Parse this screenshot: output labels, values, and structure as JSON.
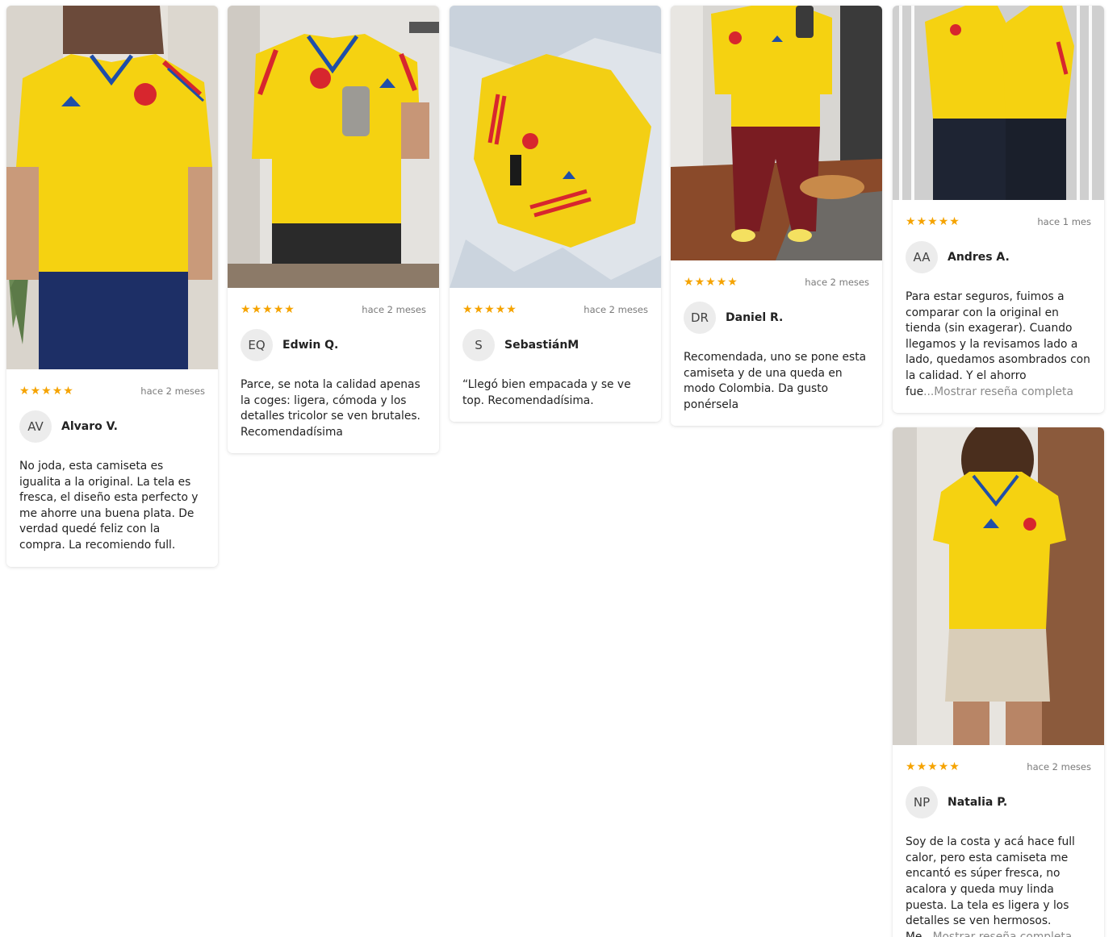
{
  "reviews": [
    {
      "stars": 5,
      "date": "hace 2 meses",
      "initials": "AV",
      "name": "Alvaro V.",
      "text": "No joda, esta camiseta es igualita a la original. La tela es fresca, el diseño esta perfecto y me ahorre una buena plata. De verdad quedé feliz con la compra. La recomiendo full.",
      "more": ""
    },
    {
      "stars": 5,
      "date": "hace 2 meses",
      "initials": "EQ",
      "name": "Edwin Q.",
      "text": "Parce, se nota la calidad apenas la coges: ligera, cómoda y los detalles tricolor se ven brutales. Recomendadísima",
      "more": ""
    },
    {
      "stars": 5,
      "date": "hace 2 meses",
      "initials": "S",
      "name": "SebastiánM",
      "text": "“Llegó bien empacada y se ve top. Recomendadísima.",
      "more": ""
    },
    {
      "stars": 5,
      "date": "hace 2 meses",
      "initials": "DR",
      "name": "Daniel R.",
      "text": "Recomendada, uno se pone esta camiseta y de una queda en modo Colombia. Da gusto ponérsela",
      "more": ""
    },
    {
      "stars": 5,
      "date": "hace 1 mes",
      "initials": "AA",
      "name": "Andres A.",
      "text": "Para estar seguros, fuimos a comparar con la original en tienda (sin exagerar). Cuando llegamos y la revisamos lado a lado, quedamos asombrados con la calidad. Y el ahorro fue",
      "more": "...Mostrar reseña completa"
    },
    {
      "stars": 5,
      "date": "hace 2 meses",
      "initials": "NP",
      "name": "Natalia P.",
      "text": "Soy de la costa y acá hace full calor, pero esta camiseta me encantó es súper fresca, no acalora y queda muy linda puesta. La tela es ligera y los detalles se ven hermosos. Me",
      "more": "...Mostrar reseña completa"
    }
  ],
  "star_glyph": "★",
  "colors": {
    "star": "#f5a300",
    "jersey": "#f5d211",
    "accent_red": "#d7262e",
    "accent_blue": "#1f4ea8"
  }
}
